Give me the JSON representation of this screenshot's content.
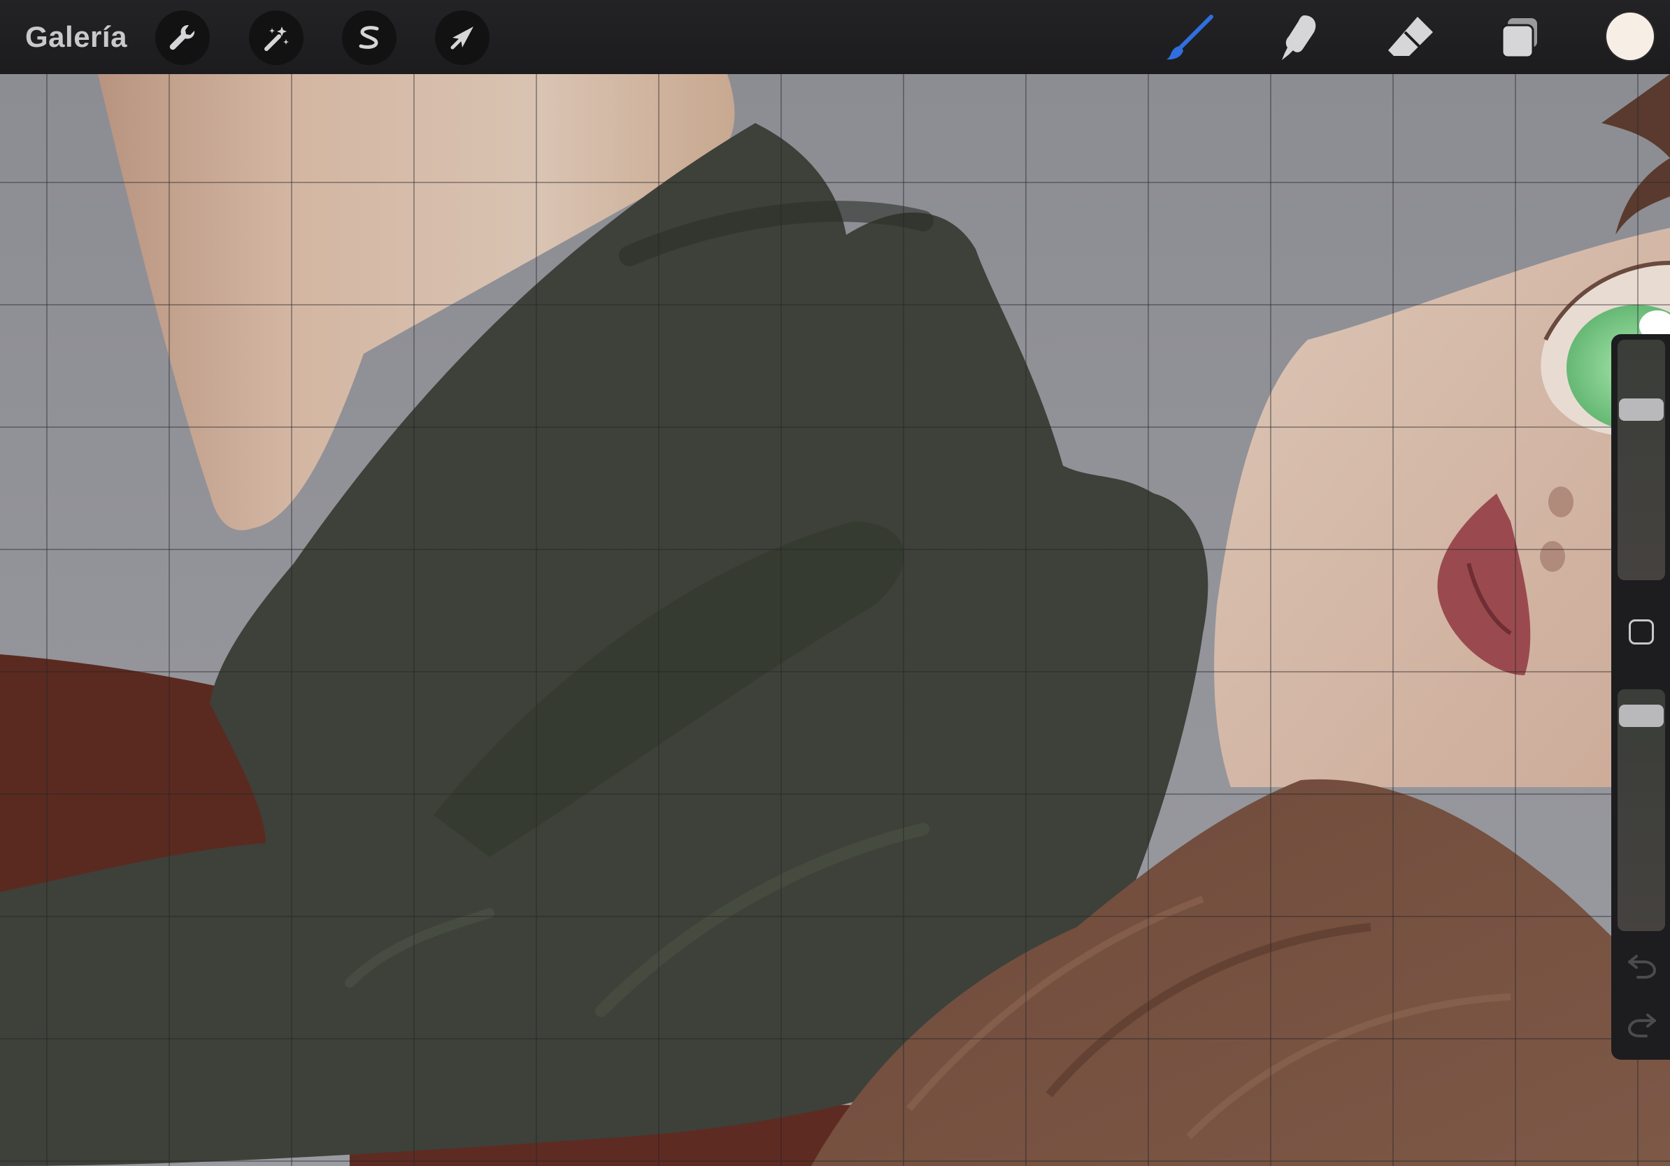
{
  "topbar": {
    "gallery_label": "Galería",
    "left_tools": [
      {
        "name": "actions",
        "icon": "wrench-icon"
      },
      {
        "name": "adjustments",
        "icon": "magic-wand-icon"
      },
      {
        "name": "selection",
        "icon": "selection-s-icon"
      },
      {
        "name": "transform",
        "icon": "arrow-cursor-icon"
      }
    ],
    "right_tools": [
      {
        "name": "brush",
        "icon": "brush-icon",
        "active": true,
        "color": "#2f6fe0"
      },
      {
        "name": "smudge",
        "icon": "smudge-finger-icon"
      },
      {
        "name": "eraser",
        "icon": "eraser-icon"
      },
      {
        "name": "layers",
        "icon": "layers-icon"
      }
    ],
    "current_color": "#f7efe6"
  },
  "sidebar": {
    "brush_size": 0.73,
    "opacity": 0.93,
    "modifier_icon": "square-modifier-icon",
    "undo_icon": "undo-arrow-icon",
    "redo_icon": "redo-arrow-icon"
  },
  "canvas": {
    "grid_visible": true,
    "colors": {
      "background": "#8f9096",
      "skin": "#d8bfae",
      "sweater": "#3e423a",
      "hair": "#7a5442",
      "red_fabric": "#5a2a20",
      "eye_green": "#7fcf88",
      "lips": "#9a4a4e"
    }
  }
}
